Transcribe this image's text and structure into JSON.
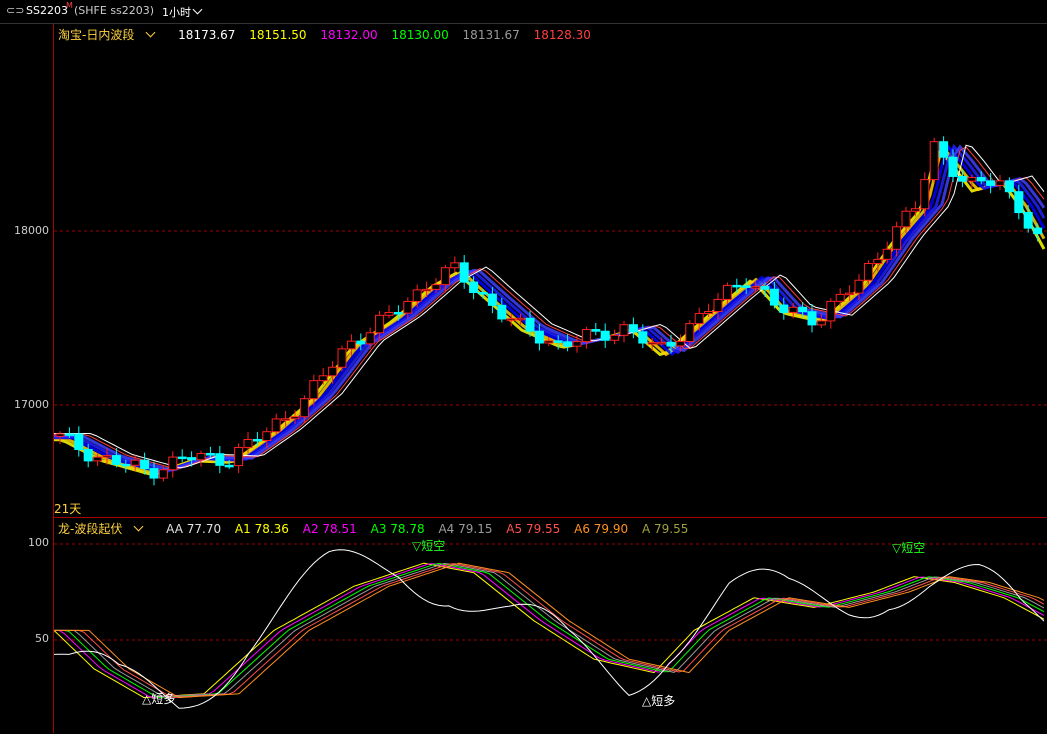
{
  "toolbar": {
    "symbol_code": "SS2203",
    "symbol_mark": "M",
    "symbol_desc": "(SHFE ss2203)",
    "period": "1小时"
  },
  "axis": {
    "tick_18000": "18000",
    "tick_17000": "17000",
    "tick_100": "100",
    "tick_50": "50"
  },
  "main": {
    "indicator_name": "淘宝-日内波段",
    "values": [
      {
        "text": "18173.67",
        "color": "#ffffff"
      },
      {
        "text": "18151.50",
        "color": "#ffff00"
      },
      {
        "text": "18132.00",
        "color": "#ff00ff"
      },
      {
        "text": "18130.00",
        "color": "#00ff00"
      },
      {
        "text": "18131.67",
        "color": "#9a9a9a"
      },
      {
        "text": "18128.30",
        "color": "#ff4040"
      }
    ],
    "bottom_label": "21天"
  },
  "sub": {
    "indicator_name": "龙-波段起伏",
    "values": [
      {
        "text": "AA 77.70",
        "color": "#e0e0e0"
      },
      {
        "text": "A1 78.36",
        "color": "#ffff00"
      },
      {
        "text": "A2 78.51",
        "color": "#ff00ff"
      },
      {
        "text": "A3 78.78",
        "color": "#00ff00"
      },
      {
        "text": "A4 79.15",
        "color": "#9a9a9a"
      },
      {
        "text": "A5 79.55",
        "color": "#ff5050"
      },
      {
        "text": "A6 79.90",
        "color": "#ff9020"
      },
      {
        "text": "A 79.55",
        "color": "#a0a040"
      }
    ],
    "signals": [
      "▽短空",
      "▽短空",
      "△短多",
      "△短多"
    ]
  },
  "colors": {
    "up": "#ff2020",
    "down": "#00ffff",
    "grid": "#a00000",
    "ma_white": "#ffffff"
  }
}
